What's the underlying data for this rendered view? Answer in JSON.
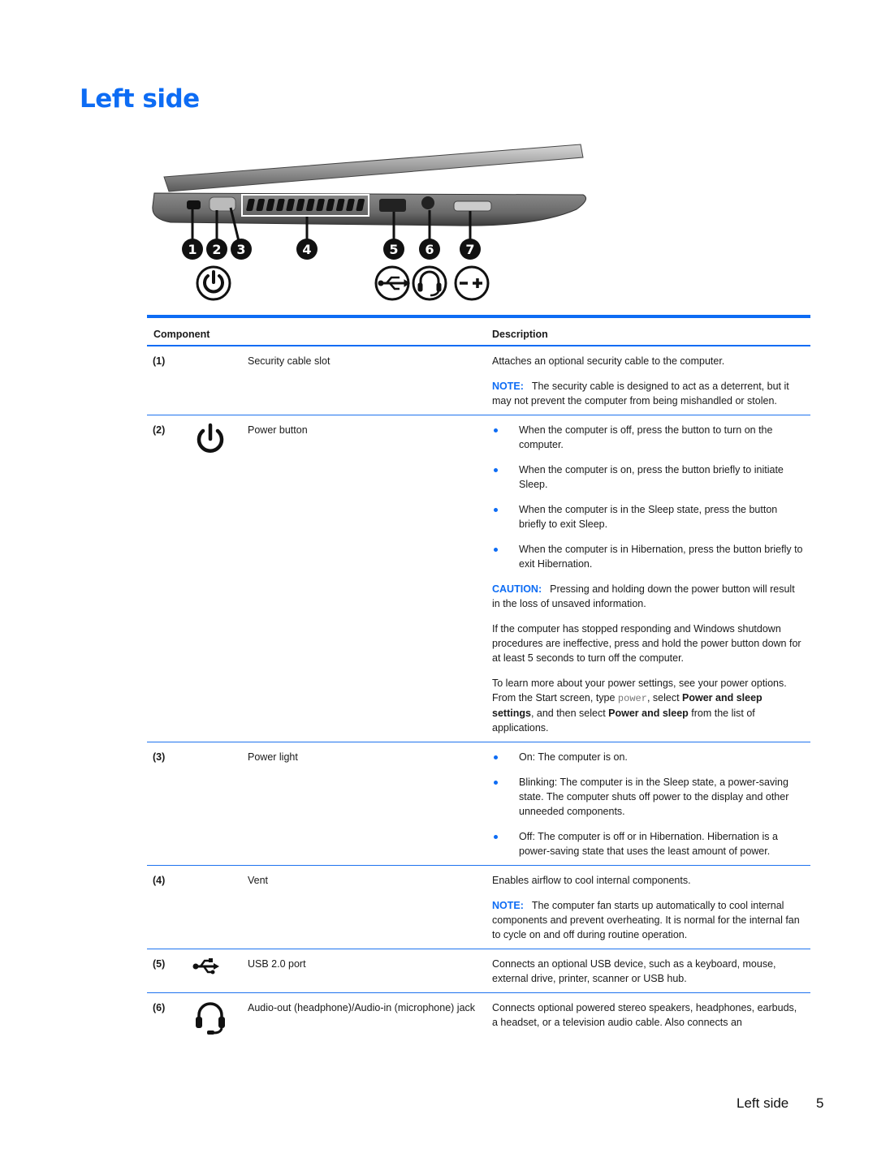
{
  "page": {
    "title": "Left side",
    "footer_section": "Left side",
    "footer_page": "5"
  },
  "callouts": [
    "1",
    "2",
    "3",
    "4",
    "5",
    "6",
    "7"
  ],
  "callout_icons": [
    "power-icon",
    "usb-icon",
    "headset-icon",
    "volume-icon"
  ],
  "table": {
    "headers": {
      "component": "Component",
      "description": "Description"
    },
    "rows": [
      {
        "num": "(1)",
        "icon": null,
        "name": "Security cable slot",
        "desc": {
          "p1": "Attaches an optional security cable to the computer.",
          "note_label": "NOTE:",
          "note_text": "The security cable is designed to act as a deterrent, but it may not prevent the computer from being mishandled or stolen."
        }
      },
      {
        "num": "(2)",
        "icon": "power-icon",
        "name": "Power button",
        "desc": {
          "bullets": [
            "When the computer is off, press the button to turn on the computer.",
            "When the computer is on, press the button briefly to initiate Sleep.",
            "When the computer is in the Sleep state, press the button briefly to exit Sleep.",
            "When the computer is in Hibernation, press the button briefly to exit Hibernation."
          ],
          "caution_label": "CAUTION:",
          "caution_text": "Pressing and holding down the power button will result in the loss of unsaved information.",
          "p_unresponsive": "If the computer has stopped responding and Windows shutdown procedures are ineffective, press and hold the power button down for at least 5 seconds to turn off the computer.",
          "p_learn_1": "To learn more about your power settings, see your power options. From the Start screen, type ",
          "p_learn_code": "power",
          "p_learn_2": ", select ",
          "p_learn_b1": "Power and sleep settings",
          "p_learn_3": ", and then select ",
          "p_learn_b2": "Power and sleep",
          "p_learn_4": " from the list of applications."
        }
      },
      {
        "num": "(3)",
        "icon": null,
        "name": "Power light",
        "desc": {
          "bullets": [
            "On: The computer is on.",
            "Blinking: The computer is in the Sleep state, a power-saving state. The computer shuts off power to the display and other unneeded components.",
            "Off: The computer is off or in Hibernation. Hibernation is a power-saving state that uses the least amount of power."
          ]
        }
      },
      {
        "num": "(4)",
        "icon": null,
        "name": "Vent",
        "desc": {
          "p1": "Enables airflow to cool internal components.",
          "note_label": "NOTE:",
          "note_text": "The computer fan starts up automatically to cool internal components and prevent overheating. It is normal for the internal fan to cycle on and off during routine operation."
        }
      },
      {
        "num": "(5)",
        "icon": "usb-icon",
        "name": "USB 2.0 port",
        "desc": {
          "p1": "Connects an optional USB device, such as a keyboard, mouse, external drive, printer, scanner or USB hub."
        }
      },
      {
        "num": "(6)",
        "icon": "headset-icon",
        "name": "Audio-out (headphone)/Audio-in (microphone) jack",
        "desc": {
          "p1": "Connects optional powered stereo speakers, headphones, earbuds, a headset, or a television audio cable. Also connects an"
        }
      }
    ]
  },
  "colors": {
    "accent": "#0d6cf4",
    "text": "#1a1a1a"
  }
}
